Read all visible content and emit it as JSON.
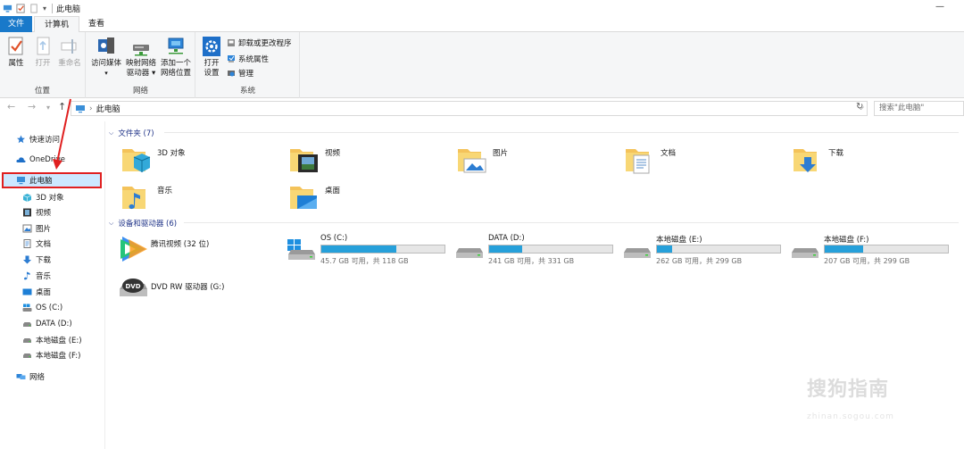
{
  "window": {
    "title": "此电脑",
    "minimize_glyph": "—"
  },
  "ribbon_tabs": [
    {
      "label": "文件",
      "active": false
    },
    {
      "label": "计算机",
      "active": true
    },
    {
      "label": "查看",
      "active": false
    }
  ],
  "ribbon": {
    "groups": {
      "location": {
        "label": "位置",
        "buttons": [
          {
            "label": "属性",
            "icon": "properties-icon",
            "enabled": true
          },
          {
            "label": "打开",
            "icon": "open-icon",
            "enabled": false
          },
          {
            "label": "重命名",
            "icon": "rename-icon",
            "enabled": false
          }
        ]
      },
      "network": {
        "label": "网络",
        "buttons": [
          {
            "label": "访问媒体",
            "icon": "media-icon"
          },
          {
            "label": "映射网络",
            "label2": "驱动器 ▾",
            "icon": "map-drive-icon"
          },
          {
            "label": "添加一个",
            "label2": "网络位置",
            "icon": "network-location-icon"
          }
        ]
      },
      "system": {
        "label": "系统",
        "open_settings": {
          "label": "打开",
          "label2": "设置",
          "icon": "settings-icon"
        },
        "small_buttons": [
          {
            "label": "卸载或更改程序",
            "icon": "uninstall-icon"
          },
          {
            "label": "系统属性",
            "icon": "system-properties-icon"
          },
          {
            "label": "管理",
            "icon": "manage-icon"
          }
        ]
      }
    }
  },
  "address": {
    "path": "此电脑",
    "search_placeholder": "搜索\"此电脑\""
  },
  "nav_pane": [
    {
      "label": "快速访问",
      "icon": "star-icon",
      "level": 0
    },
    {
      "label": "OneDrive",
      "icon": "cloud-icon",
      "level": 0
    },
    {
      "label": "此电脑",
      "icon": "pc-icon",
      "level": 0,
      "selected": true
    },
    {
      "label": "3D 对象",
      "icon": "3d-objects-icon",
      "level": 1
    },
    {
      "label": "视频",
      "icon": "video-icon",
      "level": 1
    },
    {
      "label": "图片",
      "icon": "pictures-icon",
      "level": 1
    },
    {
      "label": "文档",
      "icon": "documents-icon",
      "level": 1
    },
    {
      "label": "下载",
      "icon": "downloads-icon",
      "level": 1
    },
    {
      "label": "音乐",
      "icon": "music-icon",
      "level": 1
    },
    {
      "label": "桌面",
      "icon": "desktop-icon",
      "level": 1
    },
    {
      "label": "OS (C:)",
      "icon": "os-drive-icon",
      "level": 1
    },
    {
      "label": "DATA (D:)",
      "icon": "drive-icon",
      "level": 1
    },
    {
      "label": "本地磁盘 (E:)",
      "icon": "drive-icon",
      "level": 1
    },
    {
      "label": "本地磁盘 (F:)",
      "icon": "drive-icon",
      "level": 1
    },
    {
      "label": "网络",
      "icon": "network-icon",
      "level": 0
    }
  ],
  "folders_group": {
    "label": "文件夹 (7)"
  },
  "folders": [
    {
      "label": "3D 对象",
      "icon": "3d-objects-folder-icon"
    },
    {
      "label": "视频",
      "icon": "video-folder-icon"
    },
    {
      "label": "图片",
      "icon": "pictures-folder-icon"
    },
    {
      "label": "文档",
      "icon": "documents-folder-icon"
    },
    {
      "label": "下载",
      "icon": "downloads-folder-icon"
    },
    {
      "label": "音乐",
      "icon": "music-folder-icon"
    },
    {
      "label": "桌面",
      "icon": "desktop-folder-icon"
    }
  ],
  "devices_group": {
    "label": "设备和驱动器 (6)"
  },
  "devices": [
    {
      "label": "腾讯视频 (32 位)",
      "icon": "tencent-video-icon",
      "type": "app"
    },
    {
      "label": "OS (C:)",
      "free": "45.7 GB 可用，共 118 GB",
      "used_fraction": 0.61,
      "icon": "os-drive-icon",
      "type": "drive"
    },
    {
      "label": "DATA (D:)",
      "free": "241 GB 可用，共 331 GB",
      "used_fraction": 0.27,
      "icon": "drive-icon",
      "type": "drive"
    },
    {
      "label": "本地磁盘 (E:)",
      "free": "262 GB 可用，共 299 GB",
      "used_fraction": 0.12,
      "icon": "drive-icon",
      "type": "drive"
    },
    {
      "label": "本地磁盘 (F:)",
      "free": "207 GB 可用，共 299 GB",
      "used_fraction": 0.31,
      "icon": "drive-icon",
      "type": "drive"
    },
    {
      "label": "DVD RW 驱动器 (G:)",
      "icon": "dvd-drive-icon",
      "type": "dvd"
    }
  ],
  "watermark": {
    "text": "搜狗指南",
    "sub": "zhinan.sogou.com"
  },
  "colors": {
    "accent": "#1979ca",
    "bar_fill": "#26a0da",
    "highlight_box": "#e02020",
    "selection": "#cce8ff",
    "group_header": "#1e3287"
  }
}
